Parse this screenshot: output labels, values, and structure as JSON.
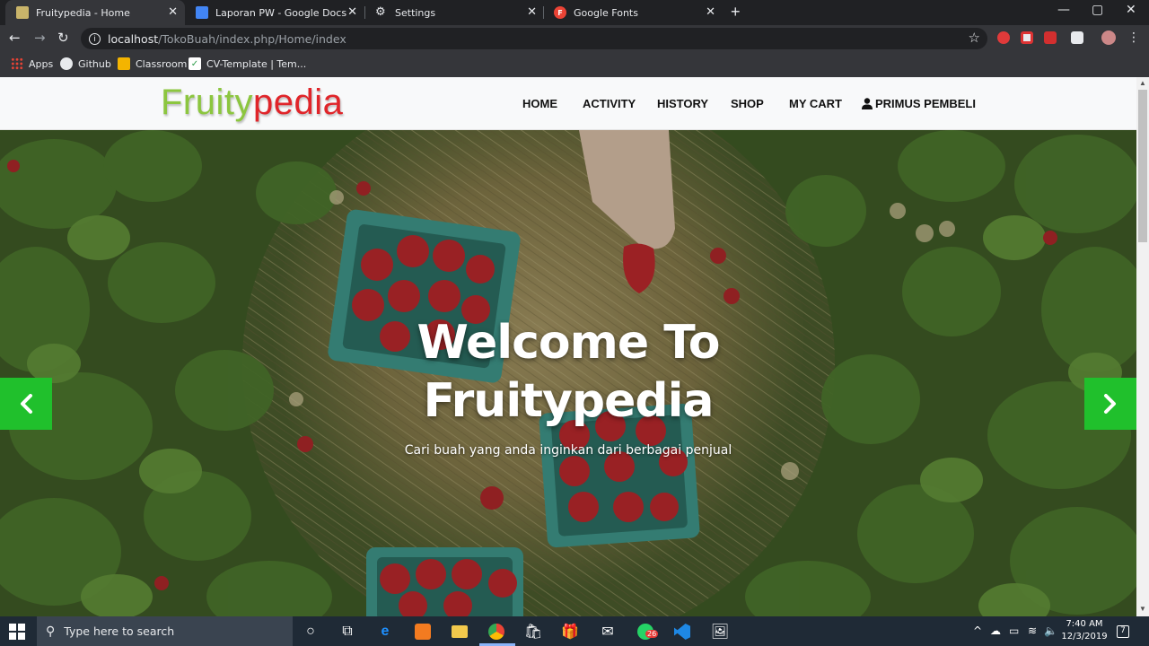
{
  "browser": {
    "tabs": [
      {
        "title": "Fruitypedia - Home",
        "active": true
      },
      {
        "title": "Laporan PW - Google Docs",
        "active": false
      },
      {
        "title": "Settings",
        "active": false
      },
      {
        "title": "Google Fonts",
        "active": false
      }
    ],
    "url_host": "localhost",
    "url_path": "/TokoBuah/index.php/Home/index",
    "bookmarks": [
      "Apps",
      "Github",
      "Classroom",
      "CV-Template | Tem..."
    ]
  },
  "site": {
    "logo_part1": "Fruity",
    "logo_part2": "pedia",
    "nav": {
      "home": "HOME",
      "activity": "ACTIVITY",
      "history": "HISTORY",
      "shop": "SHOP",
      "cart": "MY CART",
      "user": "PRIMUS PEMBELI"
    },
    "hero": {
      "title_line1": "Welcome To",
      "title_line2": "Fruitypedia",
      "subtitle": "Cari buah yang anda inginkan dari berbagai penjual"
    }
  },
  "taskbar": {
    "search_placeholder": "Type here to search",
    "time": "7:40 AM",
    "date": "12/3/2019",
    "whatsapp_badge": "26",
    "notification_count": "7"
  },
  "colors": {
    "logo_green": "#8cc63f",
    "logo_red": "#e0252a",
    "carousel_button": "#20c02c"
  }
}
